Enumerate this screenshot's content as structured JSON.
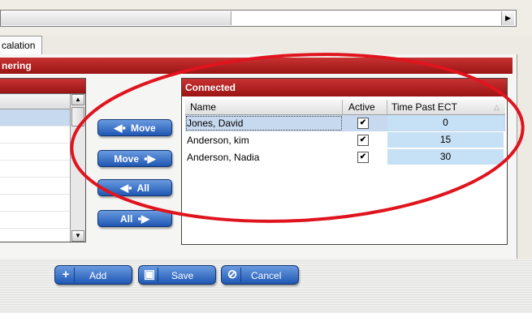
{
  "tabs": [
    {
      "label": "calation"
    }
  ],
  "section_title": "nering",
  "move_buttons": {
    "move_left": "Move",
    "move_right": "Move",
    "all_left": "All",
    "all_right": "All"
  },
  "connected": {
    "title": "Connected",
    "columns": [
      "Name",
      "Active",
      "Time Past ECT"
    ],
    "rows": [
      {
        "name": "Jones, David",
        "active": "✔",
        "time": "0"
      },
      {
        "name": "Anderson, kim",
        "active": "✔",
        "time": "15"
      },
      {
        "name": "Anderson, Nadia",
        "active": "✔",
        "time": "30"
      }
    ]
  },
  "bottom_buttons": {
    "add": "Add",
    "save": "Save",
    "cancel": "Cancel"
  },
  "colors": {
    "header_red": "#b02020",
    "button_blue": "#2f66c4",
    "annotation_red": "#e0141e"
  }
}
